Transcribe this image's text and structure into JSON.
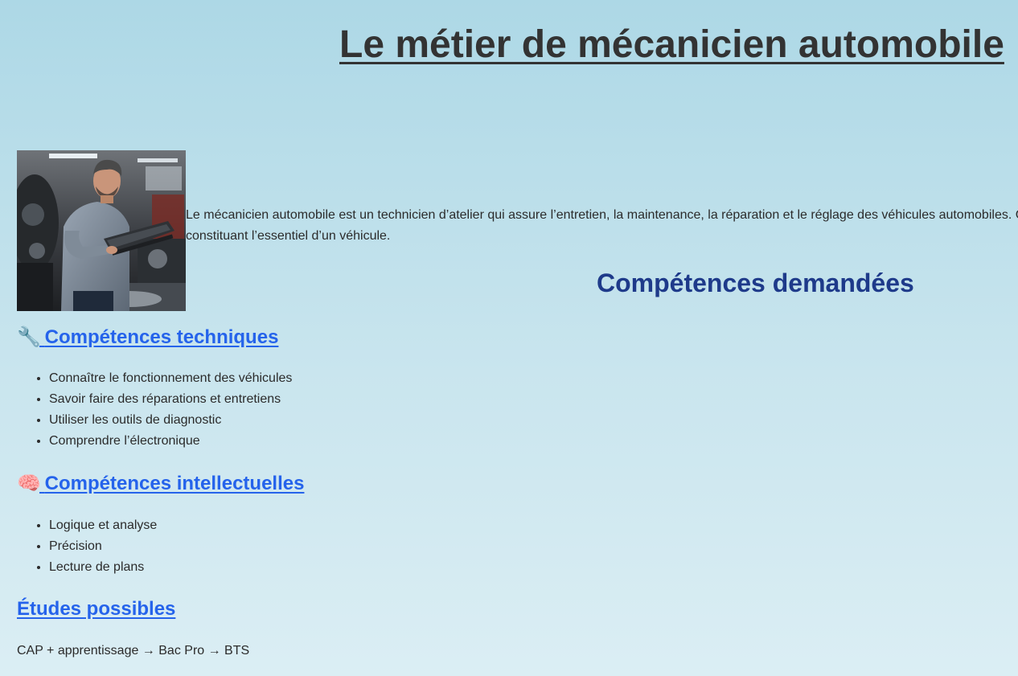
{
  "page": {
    "title": "Le métier de mécanicien automobile"
  },
  "intro": {
    "line1": "Le mécanicien automobile est un technicien d’atelier qui assure l’entretien, la maintenance, la réparation et le réglage des véhicules automobiles. C",
    "line2": "constituant l’essentiel d’un véhicule."
  },
  "skills": {
    "heading": "Compétences demandées",
    "technical": {
      "icon": "wrench-icon",
      "emoji": "🔧",
      "title": "Compétences techniques",
      "items": [
        "Connaître le fonctionnement des véhicules",
        "Savoir faire des réparations et entretiens",
        "Utiliser les outils de diagnostic",
        "Comprendre l’électronique"
      ]
    },
    "intellectual": {
      "icon": "brain-icon",
      "emoji": "🧠",
      "title": "Compétences intellectuelles",
      "items": [
        "Logique et analyse",
        "Précision",
        "Lecture de plans"
      ]
    }
  },
  "studies": {
    "title": "Études possibles",
    "path": "CAP + apprentissage → Bac Pro → BTS"
  },
  "colors": {
    "background_top": "#add8e6",
    "background_bottom": "#dbeef4",
    "link_blue": "#2563eb",
    "heading_navy": "#1e3a8a",
    "text": "#2b2b2b"
  }
}
